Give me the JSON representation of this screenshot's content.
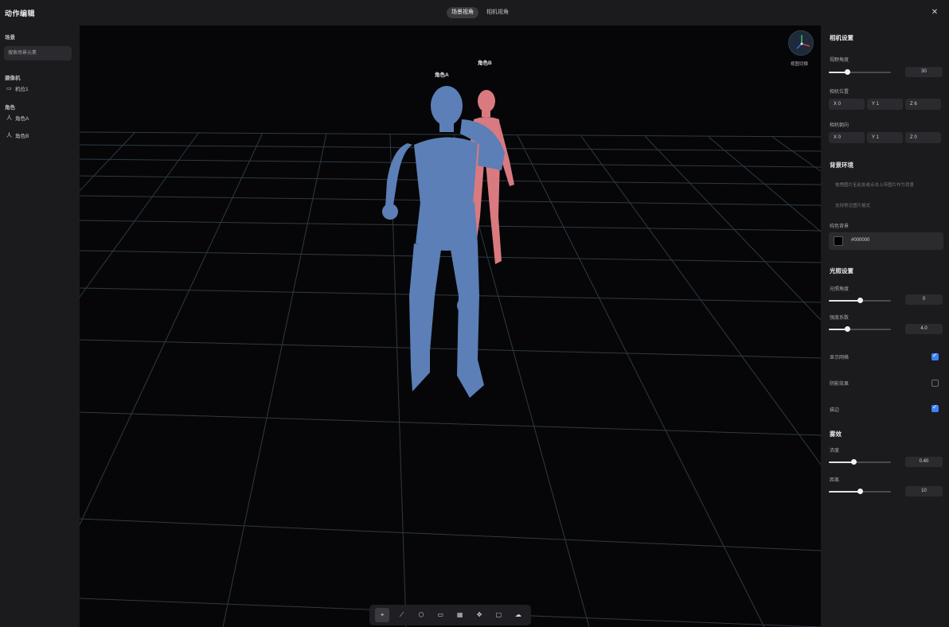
{
  "app": {
    "title": "动作编辑"
  },
  "tabs": [
    {
      "label": "场景视角",
      "active": true
    },
    {
      "label": "相机视角",
      "active": false
    }
  ],
  "left": {
    "scene_label": "场景",
    "search_placeholder": "搜索场景元素",
    "camera_label": "摄像机",
    "camera_item": "机位1",
    "characters_label": "角色",
    "characters": [
      "角色A",
      "角色B"
    ]
  },
  "viewport": {
    "label_a": "角色A",
    "label_b": "角色B",
    "gizmo_label": "视图切换",
    "tools": [
      "select-tool",
      "bone-tool",
      "shield-tool",
      "camera-tool",
      "grid-tool",
      "move-tool",
      "frame-tool",
      "cloud-tool"
    ],
    "colors": {
      "figure_a": "#5b7fb6",
      "figure_b": "#d97a80",
      "grid": "#33404a"
    }
  },
  "right": {
    "camera_title": "相机设置",
    "fov_label": "视野角度",
    "fov_value": "30",
    "fov_fraction": 0.3,
    "position_label": "相机位置",
    "position": {
      "x": "X 0",
      "y": "Y 1",
      "z": "Z 6"
    },
    "target_label": "相机朝向",
    "target": {
      "x": "X 0",
      "y": "Y 1",
      "z": "Z 0"
    },
    "bg_title": "背景环境",
    "bg_hint_1": "拖拽图片至此处或点击上传图片作为背景",
    "bg_hint_2": "支持常见图片格式",
    "solid_label": "纯色背景",
    "solid_hex": "#000000",
    "light_title": "光照设置",
    "light_angle_label": "光照角度",
    "light_angle_value": "0",
    "light_angle_fraction": 0.5,
    "intensity_label": "强度系数",
    "intensity_value": "4.0",
    "intensity_fraction": 0.3,
    "show_grid_label": "显示网格",
    "show_grid_on": true,
    "show_shadow_label": "阴影效果",
    "show_shadow_on": false,
    "outline_label": "描边",
    "outline_on": true,
    "fog_title": "雾效",
    "fog_density_label": "浓度",
    "fog_density_value": "0.40",
    "fog_density_fraction": 0.4,
    "fog_distance_label": "距离",
    "fog_distance_value": "10",
    "fog_distance_fraction": 0.5
  }
}
